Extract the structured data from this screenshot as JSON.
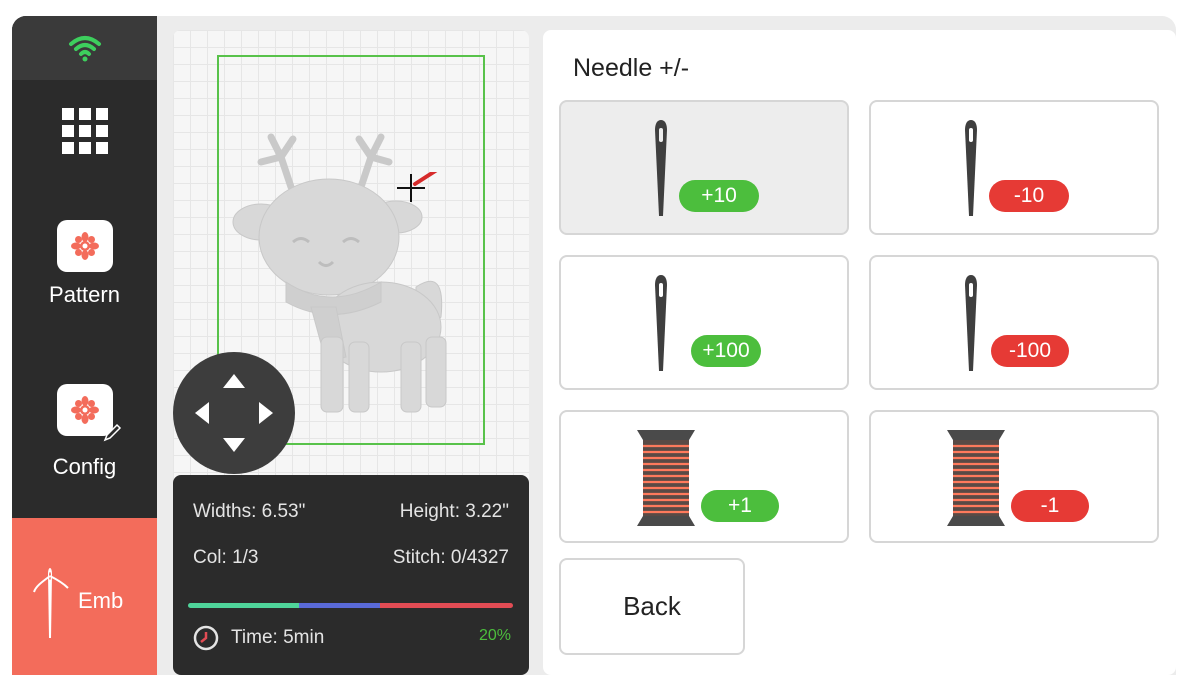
{
  "sidebar": {
    "wifi_icon": "wifi-icon",
    "apps_icon": "apps-grid-icon",
    "pattern_label": "Pattern",
    "config_label": "Config",
    "emb_label": "Emb",
    "accent_color": "#f36c5b",
    "wifi_color": "#3dcf5d"
  },
  "preview": {
    "width_text": "Widths: 6.53\"",
    "height_text": "Height: 3.22\"",
    "col_text": "Col: 1/3",
    "stitch_text": "Stitch: 0/4327",
    "time_text": "Time: 5min",
    "progress_percent_text": "20%",
    "progress_fraction": 0.2
  },
  "panel": {
    "title": "Needle +/-",
    "buttons": [
      {
        "label": "+10",
        "icon": "needle-icon",
        "color": "green"
      },
      {
        "label": "-10",
        "icon": "needle-icon",
        "color": "red"
      },
      {
        "label": "+100",
        "icon": "needle-icon",
        "color": "green"
      },
      {
        "label": "-100",
        "icon": "needle-icon",
        "color": "red"
      },
      {
        "label": "+1",
        "icon": "thread-spool-icon",
        "color": "green"
      },
      {
        "label": "-1",
        "icon": "thread-spool-icon",
        "color": "red"
      }
    ],
    "back_label": "Back"
  }
}
